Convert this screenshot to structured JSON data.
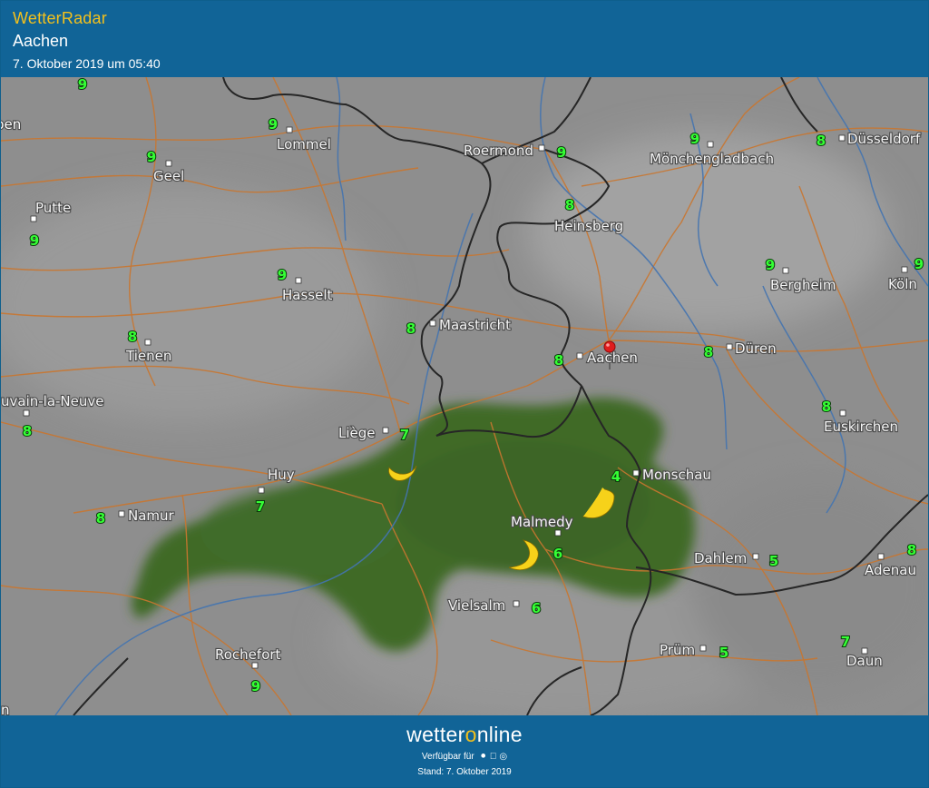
{
  "header": {
    "app_title": "WetterRadar",
    "location": "Aachen",
    "timestamp": "7. Oktober 2019 um 05:40"
  },
  "map": {
    "background_color": "#8f8f8f",
    "rain_color": "#3f6a28",
    "road_color": "#c9762f",
    "river_color": "#4474b0",
    "border_color": "#262626",
    "temperature_color": "#35ff35",
    "cities": [
      {
        "name": "Lommel",
        "temp": "9"
      },
      {
        "name": "Geel",
        "temp": "9"
      },
      {
        "name": "Putte",
        "temp": "9"
      },
      {
        "name": "Roermond",
        "temp": "9"
      },
      {
        "name": "Mönchengladbach",
        "temp": "9"
      },
      {
        "name": "Düsseldorf",
        "temp": "8"
      },
      {
        "name": "Heinsberg",
        "temp": "8"
      },
      {
        "name": "Hasselt",
        "temp": "9"
      },
      {
        "name": "Bergheim",
        "temp": "9"
      },
      {
        "name": "Köln",
        "temp": "9"
      },
      {
        "name": "Maastricht",
        "temp": "8"
      },
      {
        "name": "Tienen",
        "temp": "8"
      },
      {
        "name": "Aachen",
        "temp": "8"
      },
      {
        "name": "Düren",
        "temp": "8"
      },
      {
        "name": "uvain-la-Neuve",
        "temp": "8"
      },
      {
        "name": "Euskirchen",
        "temp": "8"
      },
      {
        "name": "Liège",
        "temp": "7"
      },
      {
        "name": "Huy",
        "temp": "7"
      },
      {
        "name": "Monschau",
        "temp": "4"
      },
      {
        "name": "Namur",
        "temp": "8"
      },
      {
        "name": "Malmedy",
        "temp": "6"
      },
      {
        "name": "Dahlem",
        "temp": "5"
      },
      {
        "name": "Adenau",
        "temp": "8"
      },
      {
        "name": "Vielsalm",
        "temp": "6"
      },
      {
        "name": "Prüm",
        "temp": "5"
      },
      {
        "name": "Daun",
        "temp": "7"
      },
      {
        "name": "Rochefort",
        "temp": "9"
      }
    ],
    "edge_labels": [
      "pen",
      "n"
    ],
    "edge_temps": [
      "9",
      "9"
    ],
    "weather_icons": [
      "moon-icon",
      "moon-icon",
      "moon-icon"
    ],
    "location_marker": "Aachen"
  },
  "footer": {
    "brand_prefix": "wetter",
    "brand_o": "o",
    "brand_suffix": "nline",
    "availability": "Verfügbar für",
    "platform_icons": [
      "android-icon",
      "apple-icon",
      "web-icon"
    ],
    "stand": "Stand: 7. Oktober 2019"
  }
}
